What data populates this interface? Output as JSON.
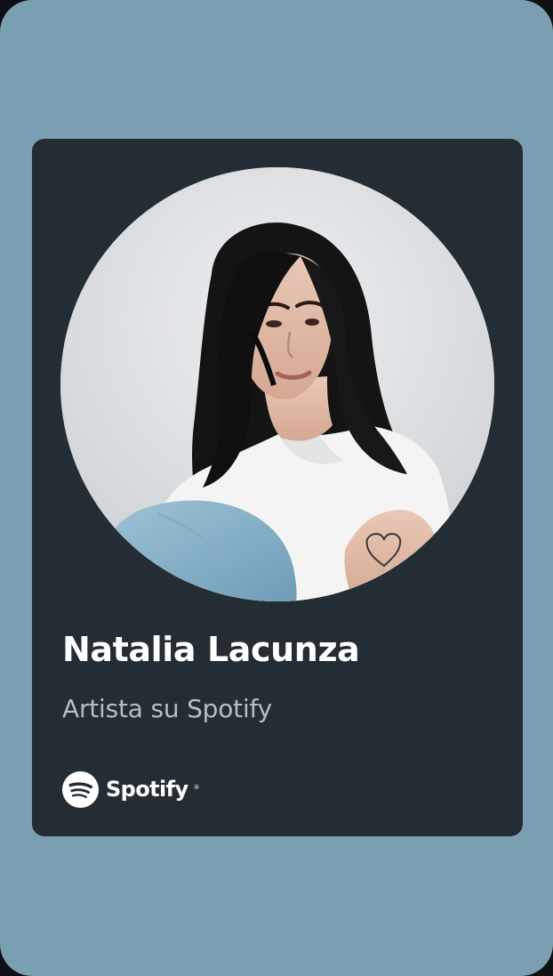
{
  "colors": {
    "background": "#7a9fb2",
    "card": "#232d33",
    "name_text": "#ffffff",
    "subtitle_text": "#b8bdc1"
  },
  "artist": {
    "name": "Natalia Lacunza",
    "subtitle": "Artista su Spotify",
    "photo_icon": "artist-photo"
  },
  "brand": {
    "icon": "spotify-logo-icon",
    "wordmark": "Spotify",
    "registered": "®"
  }
}
